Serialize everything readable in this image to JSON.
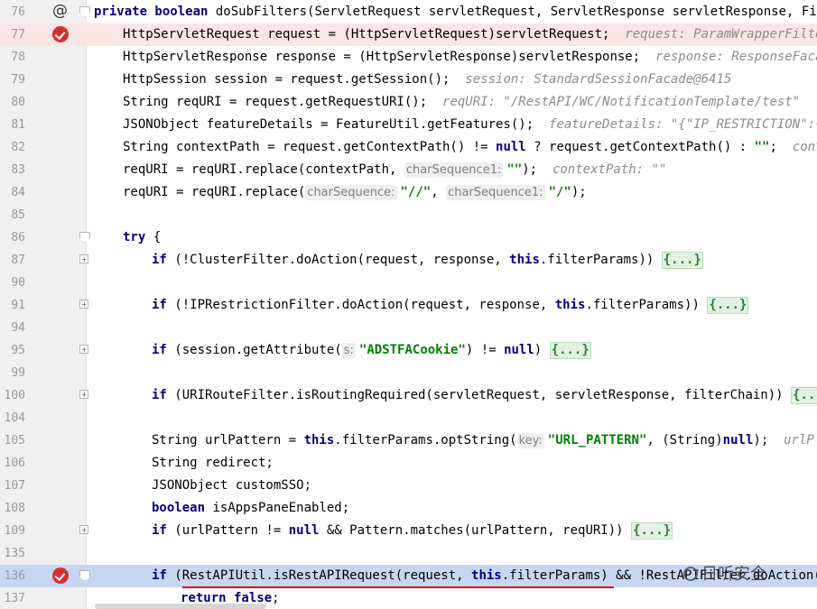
{
  "colors": {
    "keyword": "#000080",
    "string": "#008000",
    "breakpoint": "#d53030",
    "breakpoint_line": "#fae5e5",
    "selection": "#c7d7f1",
    "underline": "#e00000"
  },
  "icons": {
    "override": "@",
    "breakpoint": "breakpoint-icon",
    "fold": "fold-icon"
  },
  "watermark": "日听安全",
  "lines": [
    {
      "num": "76",
      "indent": 1,
      "markers": [
        "override",
        "fold-start"
      ],
      "tokens": [
        [
          "kw",
          "private boolean"
        ],
        [
          "t",
          " doSubFilters(ServletRequest servletRequest, ServletResponse servletResponse, Fil"
        ]
      ]
    },
    {
      "num": "77",
      "indent": 2,
      "markers": [
        "breakpoint"
      ],
      "highlight": "bp",
      "tokens": [
        [
          "t",
          "HttpServletRequest request = (HttpServletRequest)servletRequest;  "
        ],
        [
          "dbg",
          "request: ParamWrapperFilte"
        ]
      ]
    },
    {
      "num": "78",
      "indent": 2,
      "markers": [],
      "tokens": [
        [
          "t",
          "HttpServletResponse response = (HttpServletResponse)servletResponse;  "
        ],
        [
          "dbg",
          "response: ResponseFaca"
        ]
      ]
    },
    {
      "num": "79",
      "indent": 2,
      "markers": [],
      "tokens": [
        [
          "t",
          "HttpSession session = request.getSession();  "
        ],
        [
          "dbg",
          "session: StandardSessionFacade@6415"
        ]
      ]
    },
    {
      "num": "80",
      "indent": 2,
      "markers": [],
      "tokens": [
        [
          "t",
          "String reqURI = request.getRequestURI();  "
        ],
        [
          "dbg",
          "reqURI: \"/RestAPI/WC/NotificationTemplate/test\""
        ]
      ]
    },
    {
      "num": "81",
      "indent": 2,
      "markers": [],
      "tokens": [
        [
          "t",
          "JSONObject featureDetails = FeatureUtil.getFeatures();  "
        ],
        [
          "dbg",
          "featureDetails: \"{\"IP_RESTRICTION\":{"
        ]
      ]
    },
    {
      "num": "82",
      "indent": 2,
      "markers": [],
      "tokens": [
        [
          "t",
          "String contextPath = request.getContextPath() != "
        ],
        [
          "kw",
          "null"
        ],
        [
          "t",
          " ? request.getContextPath() : "
        ],
        [
          "str",
          "\"\""
        ],
        [
          "t",
          ";  "
        ],
        [
          "dbg",
          "cont"
        ]
      ]
    },
    {
      "num": "83",
      "indent": 2,
      "markers": [],
      "tokens": [
        [
          "t",
          "reqURI = reqURI.replace(contextPath, "
        ],
        [
          "inl",
          "charSequence1:"
        ],
        [
          "str",
          "\"\""
        ],
        [
          "t",
          ");  "
        ],
        [
          "dbg",
          "contextPath: \"\""
        ]
      ]
    },
    {
      "num": "84",
      "indent": 2,
      "markers": [],
      "tokens": [
        [
          "t",
          "reqURI = reqURI.replace("
        ],
        [
          "inl",
          "charSequence:"
        ],
        [
          "str",
          "\"//\""
        ],
        [
          "t",
          ", "
        ],
        [
          "inl",
          "charSequence1:"
        ],
        [
          "str",
          "\"/\""
        ],
        [
          "t",
          ");"
        ]
      ]
    },
    {
      "num": "85",
      "indent": 2,
      "markers": [],
      "tokens": []
    },
    {
      "num": "86",
      "indent": 2,
      "markers": [
        "fold-start"
      ],
      "tokens": [
        [
          "kw",
          "try"
        ],
        [
          "t",
          " {"
        ]
      ]
    },
    {
      "num": "87",
      "indent": 3,
      "markers": [
        "fold-plus"
      ],
      "tokens": [
        [
          "kw",
          "if"
        ],
        [
          "t",
          " (!ClusterFilter.doAction(request, response, "
        ],
        [
          "kw",
          "this"
        ],
        [
          "t",
          ".filterParams)) "
        ],
        [
          "fold",
          "{...}"
        ]
      ]
    },
    {
      "num": "90",
      "indent": 3,
      "markers": [],
      "tokens": []
    },
    {
      "num": "91",
      "indent": 3,
      "markers": [
        "fold-plus"
      ],
      "tokens": [
        [
          "kw",
          "if"
        ],
        [
          "t",
          " (!IPRestrictionFilter.doAction(request, response, "
        ],
        [
          "kw",
          "this"
        ],
        [
          "t",
          ".filterParams)) "
        ],
        [
          "fold",
          "{...}"
        ]
      ]
    },
    {
      "num": "94",
      "indent": 3,
      "markers": [],
      "tokens": []
    },
    {
      "num": "95",
      "indent": 3,
      "markers": [
        "fold-plus"
      ],
      "tokens": [
        [
          "kw",
          "if"
        ],
        [
          "t",
          " (session.getAttribute("
        ],
        [
          "inl",
          "s:"
        ],
        [
          "str",
          "\"ADSTFACookie\""
        ],
        [
          "t",
          ") != "
        ],
        [
          "kw",
          "null"
        ],
        [
          "t",
          ") "
        ],
        [
          "fold",
          "{...}"
        ]
      ]
    },
    {
      "num": "99",
      "indent": 3,
      "markers": [],
      "tokens": []
    },
    {
      "num": "100",
      "indent": 3,
      "markers": [
        "fold-plus"
      ],
      "tokens": [
        [
          "kw",
          "if"
        ],
        [
          "t",
          " (URIRouteFilter.isRoutingRequired(servletRequest, servletResponse, filterChain)) "
        ],
        [
          "fold",
          "{..."
        ]
      ]
    },
    {
      "num": "104",
      "indent": 3,
      "markers": [],
      "tokens": []
    },
    {
      "num": "105",
      "indent": 3,
      "markers": [],
      "tokens": [
        [
          "t",
          "String urlPattern = "
        ],
        [
          "kw",
          "this"
        ],
        [
          "t",
          ".filterParams.optString("
        ],
        [
          "inl",
          "key:"
        ],
        [
          "str",
          "\"URL_PATTERN\""
        ],
        [
          "t",
          ", (String)"
        ],
        [
          "kw",
          "null"
        ],
        [
          "t",
          ");  "
        ],
        [
          "dbg",
          "urlP"
        ]
      ]
    },
    {
      "num": "106",
      "indent": 3,
      "markers": [],
      "tokens": [
        [
          "t",
          "String redirect;"
        ]
      ]
    },
    {
      "num": "107",
      "indent": 3,
      "markers": [],
      "tokens": [
        [
          "t",
          "JSONObject customSSO;"
        ]
      ]
    },
    {
      "num": "108",
      "indent": 3,
      "markers": [],
      "tokens": [
        [
          "kw",
          "boolean"
        ],
        [
          "t",
          " isAppsPaneEnabled;"
        ]
      ]
    },
    {
      "num": "109",
      "indent": 3,
      "markers": [
        "fold-plus"
      ],
      "tokens": [
        [
          "kw",
          "if"
        ],
        [
          "t",
          " (urlPattern != "
        ],
        [
          "kw",
          "null"
        ],
        [
          "t",
          " && Pattern.matches(urlPattern, reqURI)) "
        ],
        [
          "fold",
          "{...}"
        ]
      ]
    },
    {
      "num": "135",
      "indent": 3,
      "markers": [],
      "tokens": []
    },
    {
      "num": "136",
      "indent": 3,
      "markers": [
        "breakpoint",
        "fold-start"
      ],
      "highlight": "sel",
      "tokens": [
        [
          "kw",
          "if"
        ],
        [
          "t",
          " (RestAPIUtil.isRestAPIRequest(request, "
        ],
        [
          "kw",
          "this"
        ],
        [
          "t",
          ".filterParams) && !RestAPIFilter.doAction("
        ]
      ]
    },
    {
      "num": "137",
      "indent": 4,
      "markers": [],
      "tokens": [
        [
          "kw",
          "return false"
        ],
        [
          "t",
          ";"
        ]
      ]
    }
  ]
}
